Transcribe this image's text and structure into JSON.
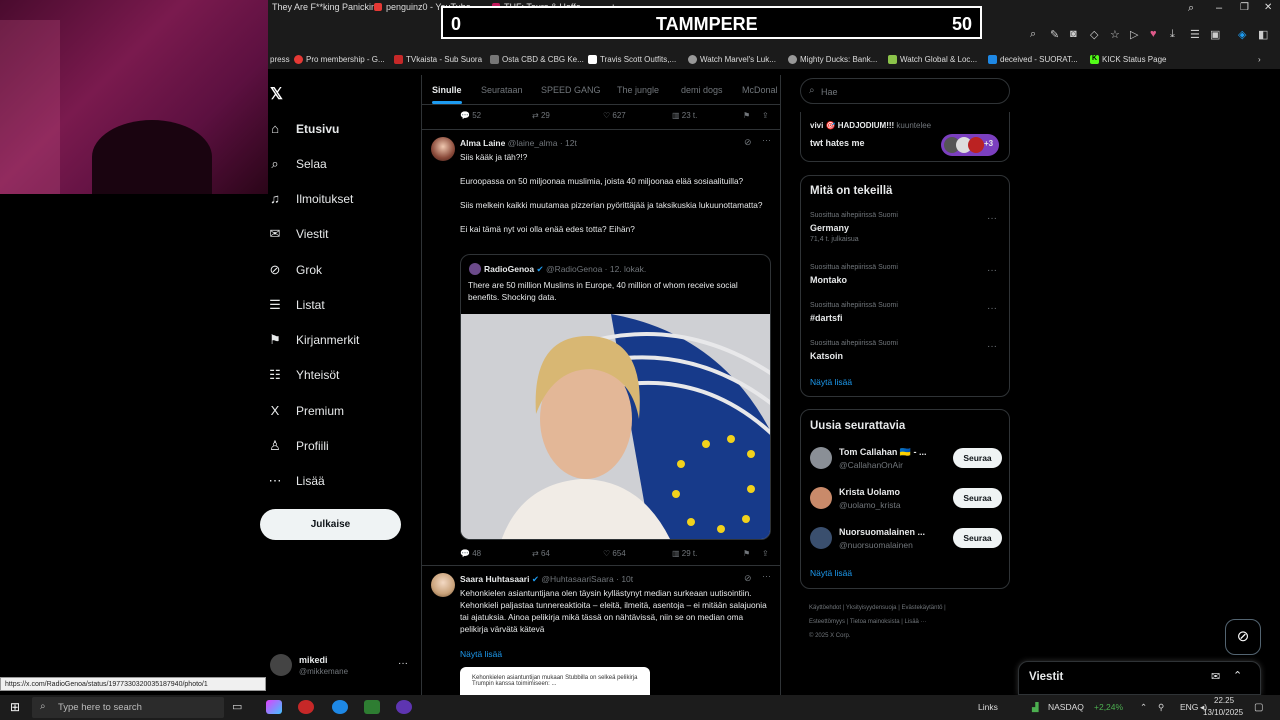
{
  "browser": {
    "tabs": [
      "They Are F**king Panickin",
      "penguinz0 - YouTube",
      "THF: Tours & Hoffe..."
    ],
    "bookmarks": [
      "press",
      "Pro membership - G...",
      "TVkaista - Sub Suora",
      "Osta CBD & CBG Ke...",
      "Travis Scott Outfits,...",
      "Watch Marvel's Luk...",
      "Mighty Ducks: Bank...",
      "Watch Global & Loc...",
      "deceived - SUORAT...",
      "KICK Status Page"
    ]
  },
  "scoreboard": {
    "left": "0",
    "title": "TAMMPERE",
    "right": "50"
  },
  "nav": {
    "items": [
      {
        "icon": "home-icon",
        "glyph": "⌂",
        "label": "Etusivu"
      },
      {
        "icon": "search-icon",
        "glyph": "⌕",
        "label": "Selaa"
      },
      {
        "icon": "bell-icon",
        "glyph": "♫",
        "label": "Ilmoitukset"
      },
      {
        "icon": "mail-icon",
        "glyph": "✉",
        "label": "Viestit"
      },
      {
        "icon": "grok-icon",
        "glyph": "⊘",
        "label": "Grok"
      },
      {
        "icon": "list-icon",
        "glyph": "☰",
        "label": "Listat"
      },
      {
        "icon": "bookmark-icon",
        "glyph": "⚑",
        "label": "Kirjanmerkit"
      },
      {
        "icon": "communities-icon",
        "glyph": "☷",
        "label": "Yhteisöt"
      },
      {
        "icon": "x-logo-icon",
        "glyph": "X",
        "label": "Premium"
      },
      {
        "icon": "profile-icon",
        "glyph": "♙",
        "label": "Profiili"
      },
      {
        "icon": "more-circle-icon",
        "glyph": "⋯",
        "label": "Lisää"
      }
    ],
    "post_button": "Julkaise",
    "account": {
      "name": "mikedi",
      "handle": "@mikkemane"
    }
  },
  "feed": {
    "tabs": [
      "Sinulle",
      "Seurataan",
      "SPEED GANG",
      "The jungle",
      "demi dogs",
      "McDonal"
    ],
    "prev_actions": {
      "replies": "52",
      "reposts": "29",
      "likes": "627",
      "views": "23 t."
    },
    "tweet1": {
      "name": "Alma Laine",
      "handle": "@laine_alma",
      "time": "· 12t",
      "text": "Siis kääk ja täh?!?\n\nEuroopassa on 50 miljoonaa muslimia, joista 40 miljoonaa elää sosiaalituilla?\n\nSiis melkein kaikki muutamaa pizzerian pyörittäjää ja taksikuskia lukuunottamatta?\n\nEi kai tämä nyt voi olla enää edes totta? Eihän?",
      "quote": {
        "name": "RadioGenoa",
        "handle": "@RadioGenoa",
        "time": "· 12. lokak.",
        "text": "There are 50 million Muslims in Europe, 40 million of whom receive social benefits. Shocking data."
      },
      "actions": {
        "replies": "48",
        "reposts": "64",
        "likes": "654",
        "views": "29 t."
      }
    },
    "tweet2": {
      "name": "Saara Huhtasaari",
      "handle": "@HuhtasaariSaara",
      "time": "· 10t",
      "text": "Kehonkielen asiantuntijana olen täysin kyllästynyt median surkeaan uutisointiin.\nKehonkieli paljastaa tunnereaktioita – eleitä, ilmeitä, asentoja – ei mitään salajuonia tai ajatuksia. Ainoa pelikirja mikä tässä on nähtävissä, niin se on median oma pelikirja värvätä kätevä",
      "show_more": "Näytä lisää",
      "card_text": "Kehonkielen asiantuntijan mukaan Stubbilla on selkeä pelikirja Trumpin kanssa toimimiseen: ..."
    }
  },
  "right": {
    "search_placeholder": "Hae",
    "space": {
      "host": "vivi 🎯 HADJODIUM!!!",
      "host_suffix": "kuuntelee",
      "title": "twt hates me",
      "count": "+3"
    },
    "trends_title": "Mitä on tekeillä",
    "trends": [
      {
        "category": "Suosittua aihepiirissä Suomi",
        "name": "Germany",
        "count": "71,4 t. julkaisua"
      },
      {
        "category": "Suosittua aihepiirissä Suomi",
        "name": "Montako",
        "count": ""
      },
      {
        "category": "Suosittua aihepiirissä Suomi",
        "name": "#dartsfi",
        "count": ""
      },
      {
        "category": "Suosittua aihepiirissä Suomi",
        "name": "Katsoin",
        "count": ""
      }
    ],
    "show_more": "Näytä lisää",
    "who_title": "Uusia seurattavia",
    "who": [
      {
        "name": "Tom Callahan 🇺🇦 - ...",
        "handle": "@CallahanOnAir",
        "button": "Seuraa",
        "color": "#8a8f96"
      },
      {
        "name": "Krista Uolamo",
        "handle": "@uolamo_krista",
        "button": "Seuraa",
        "color": "#c98a6a"
      },
      {
        "name": "Nuorsuomalainen ...",
        "handle": "@nuorsuomalainen",
        "button": "Seuraa",
        "color": "#3a4f6e"
      }
    ],
    "who_show_more": "Näytä lisää",
    "footer": [
      "Käyttöehdot",
      "Yksityisyydensuoja",
      "Evästekäytäntö",
      "Esteettömyys",
      "Tietoa mainoksista",
      "Lisää ···",
      "© 2025 X Corp."
    ]
  },
  "messages": {
    "title": "Viestit"
  },
  "status_url": "https://x.com/RadioGenoa/status/1977330320035187940/photo/1",
  "taskbar": {
    "search_placeholder": "Type here to search",
    "links": "Links",
    "ticker": "NASDAQ",
    "ticker_change": "+2,24%",
    "lang": "ENG",
    "time": "22.25",
    "date": "13/10/2025"
  }
}
